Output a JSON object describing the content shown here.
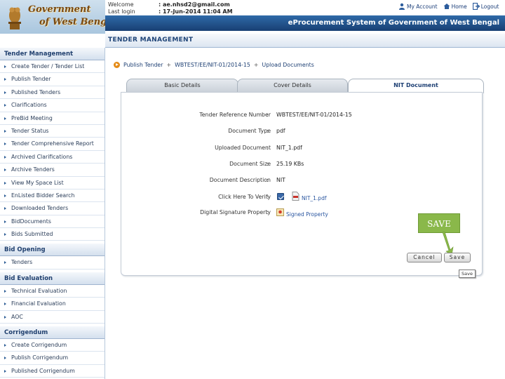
{
  "header": {
    "brand_line1": "Government",
    "brand_line2": "of West Bengal",
    "welcome_label": "Welcome",
    "welcome_value": ": ae.nhsd2@gmail.com",
    "last_login_label": "Last login",
    "last_login_value": ": 17-Jun-2014 11:04 AM",
    "links": [
      {
        "label": "My Account",
        "icon": "user-icon"
      },
      {
        "label": "Home",
        "icon": "home-icon"
      },
      {
        "label": "Logout",
        "icon": "logout-icon"
      }
    ],
    "system_title": "eProcurement System of Government of West Bengal"
  },
  "section_heading": "TENDER MANAGEMENT",
  "sidebar": {
    "groups": [
      {
        "title": "Tender Management",
        "items": [
          "Create Tender / Tender List",
          "Publish Tender",
          "Published Tenders",
          "Clarifications",
          "PreBid Meeting",
          "Tender Status",
          "Tender Comprehensive Report",
          "Archived Clarifications",
          "Archive Tenders",
          "View My Space List",
          "EnListed Bidder Search",
          "Downloaded Tenders",
          "BidDocuments",
          "Bids Submitted"
        ]
      },
      {
        "title": "Bid Opening",
        "items": [
          "Tenders"
        ]
      },
      {
        "title": "Bid Evaluation",
        "items": [
          "Technical Evaluation",
          "Financial Evaluation",
          "AOC"
        ]
      },
      {
        "title": "Corrigendum",
        "items": [
          "Create Corrigendum",
          "Publish Corrigendum",
          "Published Corrigendum"
        ]
      }
    ]
  },
  "breadcrumb": {
    "items": [
      "Publish Tender",
      "WBTEST/EE/NIT-01/2014-15",
      "Upload Documents"
    ],
    "separator": "+"
  },
  "tabs": [
    {
      "label": "Basic Details",
      "active": false
    },
    {
      "label": "Cover Details",
      "active": false
    },
    {
      "label": "NIT Document",
      "active": true
    }
  ],
  "form": {
    "colon": ":",
    "rows": [
      {
        "label": "Tender Reference Number",
        "value": "WBTEST/EE/NIT-01/2014-15"
      },
      {
        "label": "Document Type",
        "value": "pdf"
      },
      {
        "label": "Uploaded Document",
        "value": "NIT_1.pdf"
      },
      {
        "label": "Document Size",
        "value": "25.19  KBs"
      },
      {
        "label": "Document Description",
        "value": "NIT"
      },
      {
        "label": "Click Here To Verify",
        "value": ""
      },
      {
        "label": "Digital Signature Property",
        "value": ""
      }
    ],
    "verify_link": "NIT_1.pdf",
    "signature_link": "Signed Property"
  },
  "buttons": {
    "cancel": "Cancel",
    "save": "Save"
  },
  "callout": "SAVE",
  "tooltip": "Save",
  "colors": {
    "title_bar": "#1d4a86",
    "callout": "#8ab84a",
    "link": "#2a56a0"
  }
}
